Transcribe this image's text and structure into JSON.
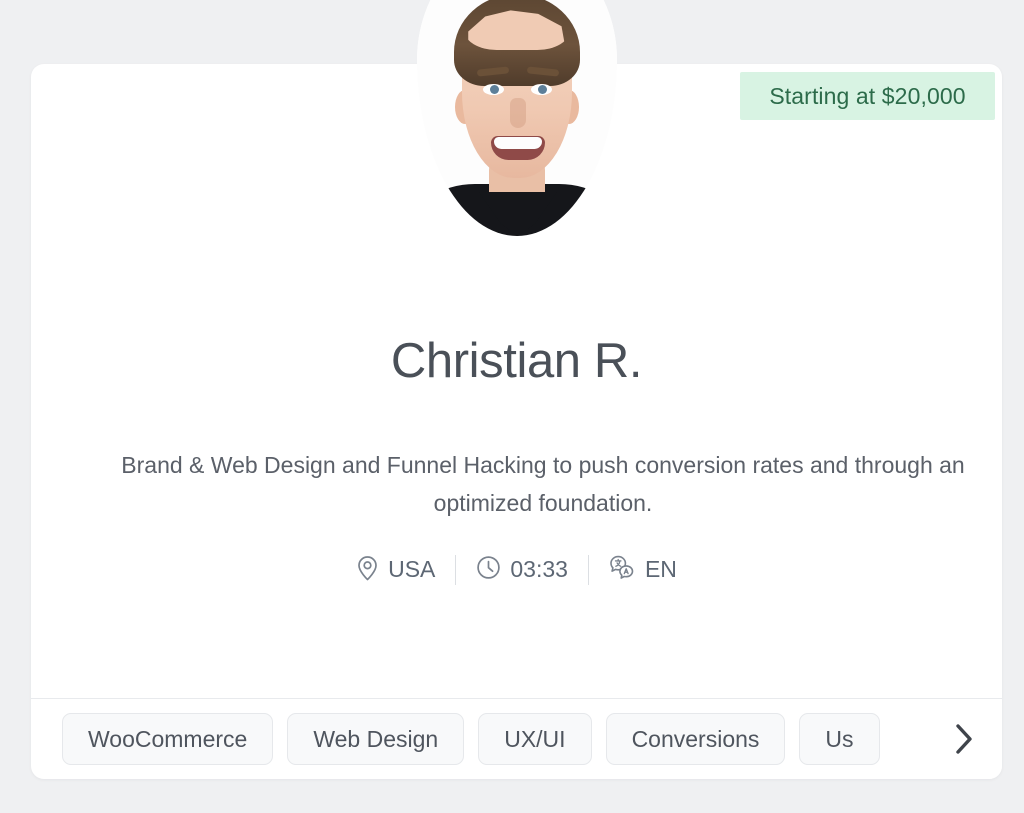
{
  "badge": {
    "price_label": "Starting at $20,000"
  },
  "profile": {
    "name": "Christian R.",
    "description": "Brand & Web Design and Funnel Hacking to push conversion rates and through an optimized foundation.",
    "avatar_alt": "Christian R. profile photo"
  },
  "meta": [
    {
      "icon": "map-pin-icon",
      "label": "USA"
    },
    {
      "icon": "clock-icon",
      "label": "03:33"
    },
    {
      "icon": "translate-icon",
      "label": "EN"
    }
  ],
  "tags": [
    {
      "label": "WooCommerce"
    },
    {
      "label": "Web Design"
    },
    {
      "label": "UX/UI"
    },
    {
      "label": "Conversions"
    },
    {
      "label": "Us"
    }
  ],
  "controls": {
    "next_label": "›"
  },
  "colors": {
    "page_background": "#eff0f2",
    "card_background": "#ffffff",
    "badge_background": "#d8f3e3",
    "badge_text": "#2c6b4a",
    "name_text": "#4a5058",
    "body_text": "#5b6069",
    "meta_text": "#5d6774",
    "tag_background": "#f8f9fa",
    "tag_border": "#e6e8eb",
    "divider": "#e8eaed"
  }
}
